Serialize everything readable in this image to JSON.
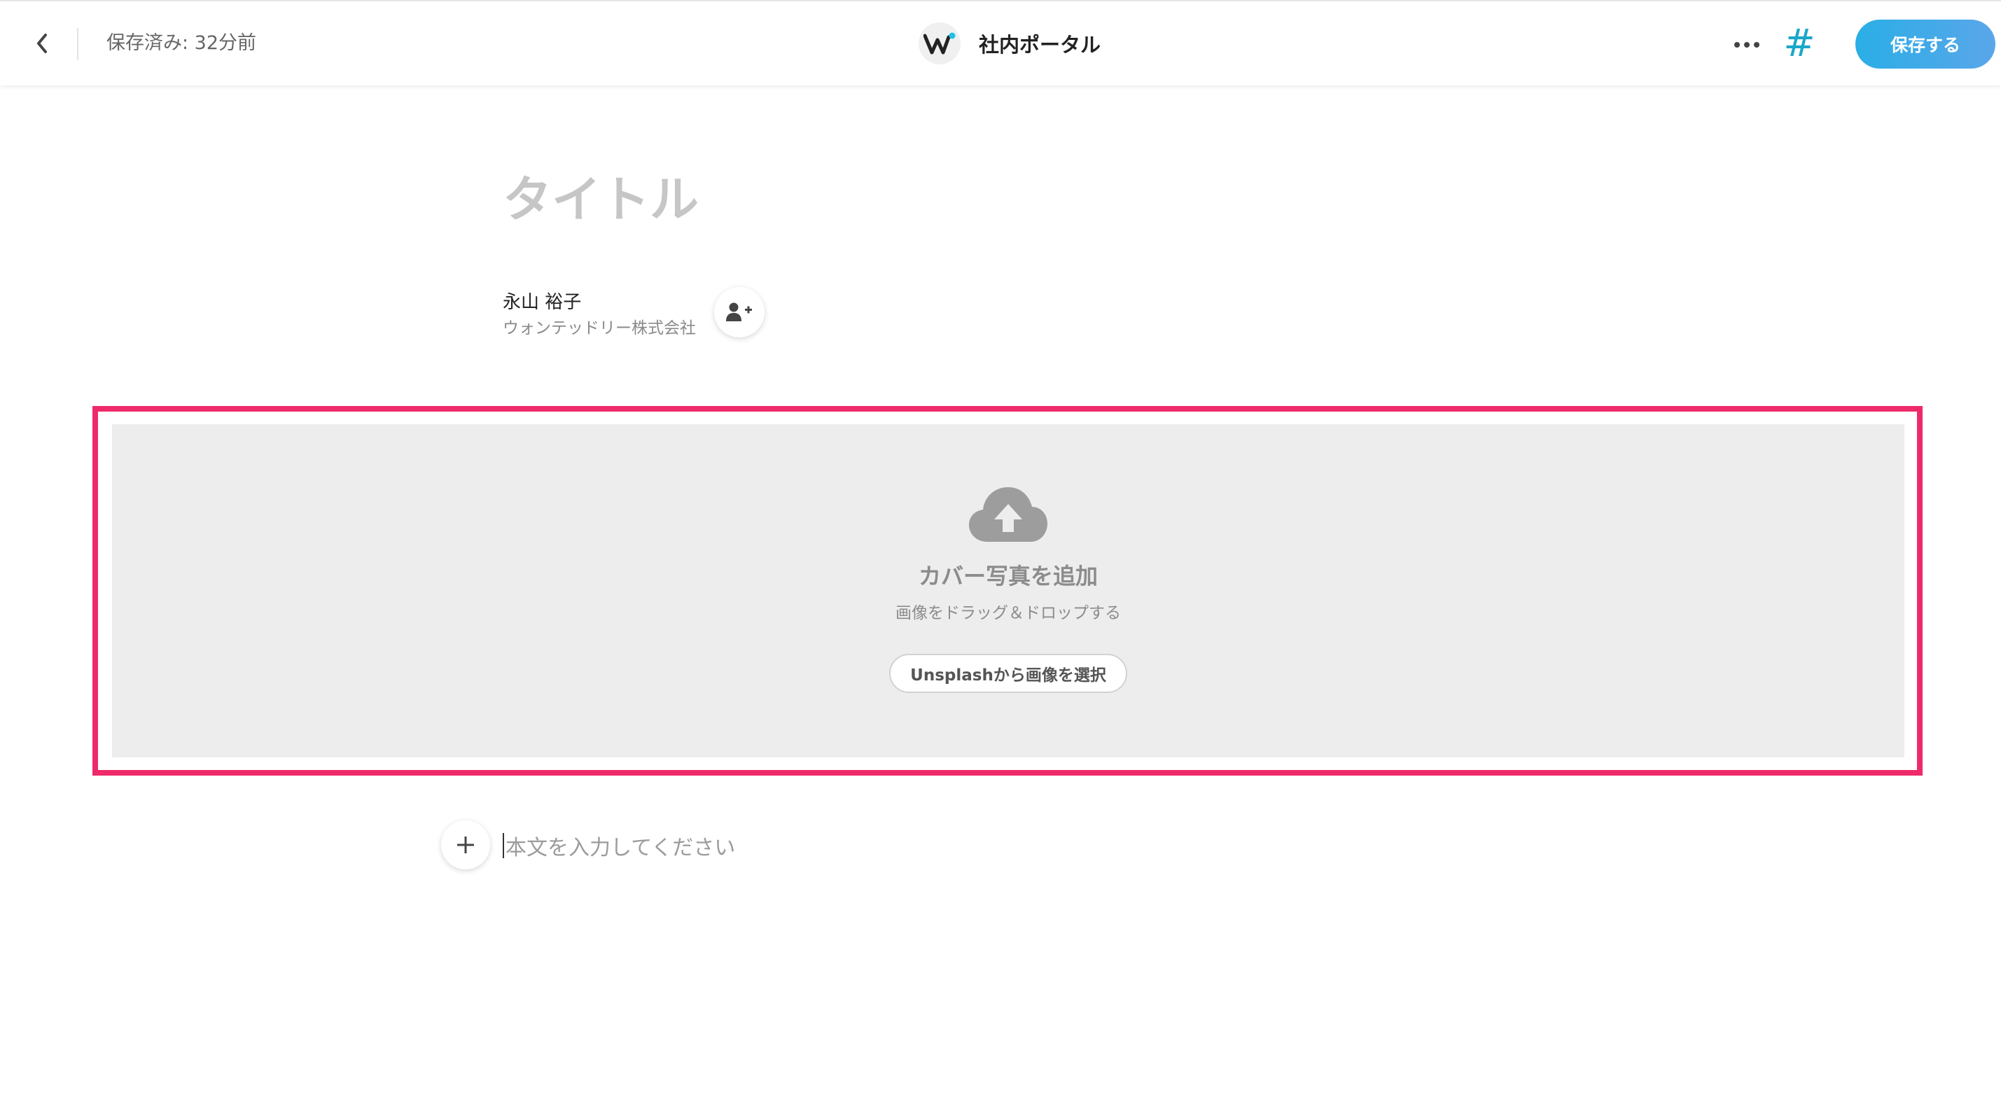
{
  "header": {
    "save_status": "保存済み: 32分前",
    "brand_name": "社内ポータル",
    "hashtag_label": "#",
    "save_button_label": "保存する"
  },
  "post": {
    "title_placeholder": "タイトル",
    "author_name": "永山 裕子",
    "author_company": "ウォンテッドリー株式会社"
  },
  "cover": {
    "title": "カバー写真を追加",
    "subtitle": "画像をドラッグ＆ドロップする",
    "unsplash_button_label": "Unsplashから画像を選択"
  },
  "body": {
    "placeholder": "本文を入力してください"
  },
  "colors": {
    "accent": "#2aaee6",
    "hashtag": "#1aa7c9",
    "highlight": "#ee2a6a",
    "dropzone_bg": "#ededed"
  },
  "icons": {
    "back": "chevron-left-icon",
    "logo": "wantedly-logo",
    "more": "more-horizontal-icon",
    "add_author": "add-user-icon",
    "upload": "cloud-upload-icon",
    "add_block": "plus-icon"
  }
}
